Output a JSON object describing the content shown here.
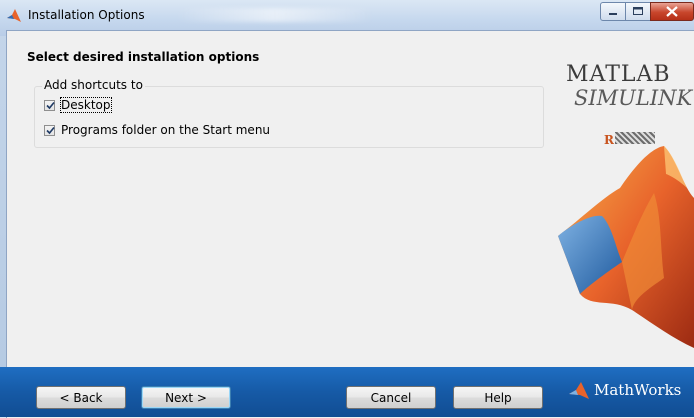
{
  "window": {
    "title": "Installation Options",
    "title_icon": "matlab-membrane-icon",
    "controls": [
      "minimize-icon",
      "maximize-icon",
      "close-icon"
    ]
  },
  "main": {
    "heading": "Select desired installation options",
    "shortcuts_group": {
      "legend": "Add shortcuts to",
      "options": [
        {
          "label": "Desktop",
          "checked": true
        },
        {
          "label": "Programs folder on the Start menu",
          "checked": true
        }
      ]
    }
  },
  "branding": {
    "matlab": "MATLAB",
    "simulink": "SIMULINK",
    "release_prefix": "R",
    "mathworks": "MathWorks"
  },
  "footer": {
    "back_label": "< Back",
    "next_label": "Next >",
    "cancel_label": "Cancel",
    "help_label": "Help"
  },
  "colors": {
    "footer_bar": "#165aa6",
    "membrane_orange": "#e8632b",
    "membrane_blue": "#3b7fc4"
  }
}
